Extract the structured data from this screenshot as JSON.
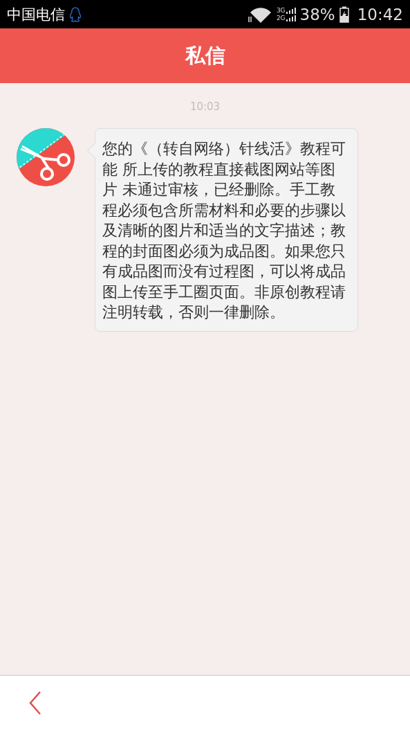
{
  "status_bar": {
    "carrier": "中国电信",
    "network_3g": "3G",
    "network_2g": "2G",
    "battery": "38%",
    "time": "10:42"
  },
  "header": {
    "title": "私信"
  },
  "messages": [
    {
      "time": "10:03",
      "text": "您的《（转自网络）针线活》教程可能 所上传的教程直接截图网站等图片 未通过审核，已经删除。手工教程必须包含所需材料和必要的步骤以及清晰的图片和适当的文字描述；教程的封面图必须为成品图。如果您只有成品图而没有过程图，可以将成品图上传至手工圈页面。非原创教程请注明转载，否则一律删除。"
    }
  ]
}
